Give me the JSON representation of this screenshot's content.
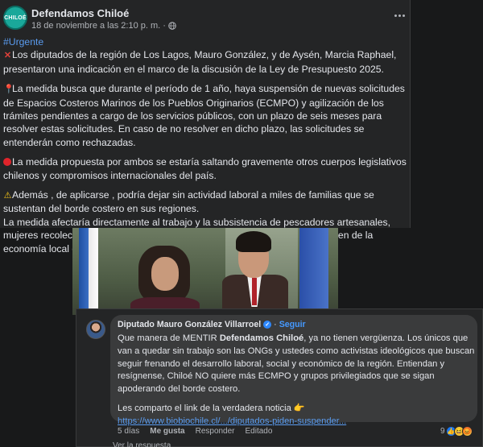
{
  "post": {
    "page_name": "Defendamos Chiloé",
    "avatar_text": "CHILOÉ",
    "timestamp": "18 de noviembre a las 2:10 p. m.",
    "visibility_icon": "globe-icon",
    "more_icon": "more-horizontal-icon",
    "hashtag": "#Urgente",
    "paragraphs": {
      "p1_emoji": "✕",
      "p1": "Los diputados de la región de Los Lagos, Mauro González, y de Aysén, Marcia Raphael, presentaron una indicación en el marco de la discusión de la Ley de Presupuesto 2025.",
      "p2_emoji": "📍",
      "p2": "La medida busca que durante el período de 1 año, haya suspensión de nuevas solicitudes de Espacios Costeros Marinos de los Pueblos Originarios (ECMPO) y agilización de los trámites pendientes a cargo de los servicios públicos, con un plazo de seis meses para resolver estas solicitudes. En caso de no resolver en dicho plazo, las solicitudes se entenderán como rechazadas.",
      "p3": "La medida propuesta por ambos se estaría saltando gravemente otros cuerpos legislativos chilenos y compromisos internacionales del país.",
      "p4_emoji": "⚠",
      "p4": "Además , de aplicarse , podría dejar sin actividad laboral a miles de familias que se sustentan del borde costero en sus regiones.",
      "p5": "La medida afectaría directamente al trabajo y la subsistencia de pescadores artesanales, mujeres recolectoras de orilla, algueros (as) y  mujeres jefas de hogar que viven de la economía local que genera el mar."
    }
  },
  "comment": {
    "author": "Diputado Mauro González Villarroel",
    "verified_icon": "verified-badge-icon",
    "verified_glyph": "✓",
    "separator": "·",
    "follow_label": "Seguir",
    "text_before_bold": "Que manera de MENTIR ",
    "bold": "Defendamos Chiloé",
    "text_after_bold": ", ya no tienen vergüenza. Los únicos que van a quedar sin trabajo son las ONGs y ustedes como activistas ideológicos que buscan seguir frenando el desarrollo laboral, social y económico de la región. Entiendan y resígnense, Chiloé NO quiere más ECMPO y grupos privilegiados que se sigan apoderando del borde costero.",
    "share_text": "Les comparto el link de la verdadera noticia ",
    "share_emoji": "👉",
    "link": "https://www.biobiochile.cl/.../diputados-piden-suspender...",
    "time": "5 días",
    "like_label": "Me gusta",
    "reply_label": "Responder",
    "edited_label": "Editado",
    "reaction_count": "9",
    "reaction_icons": [
      "like-reaction-icon",
      "laugh-reaction-icon",
      "angry-reaction-icon"
    ],
    "reaction_glyphs": [
      "👍",
      "😆",
      "😡"
    ]
  },
  "footer_cut_text": "Ver la respuesta"
}
